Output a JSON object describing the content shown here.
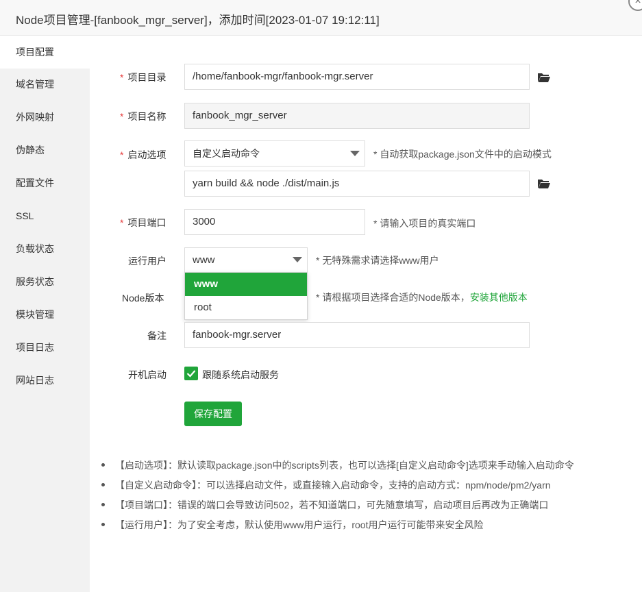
{
  "window": {
    "title": "Node项目管理-[fanbook_mgr_server]，添加时间[2023-01-07 19:12:11]",
    "close_glyph": "×"
  },
  "sidebar": {
    "items": [
      {
        "label": "项目配置",
        "active": true
      },
      {
        "label": "域名管理"
      },
      {
        "label": "外网映射"
      },
      {
        "label": "伪静态"
      },
      {
        "label": "配置文件"
      },
      {
        "label": "SSL"
      },
      {
        "label": "负载状态"
      },
      {
        "label": "服务状态"
      },
      {
        "label": "模块管理"
      },
      {
        "label": "项目日志"
      },
      {
        "label": "网站日志"
      }
    ]
  },
  "form": {
    "required_mark": "*",
    "project_dir": {
      "label": "项目目录",
      "value": "/home/fanbook-mgr/fanbook-mgr.server"
    },
    "project_name": {
      "label": "项目名称",
      "value": "fanbook_mgr_server"
    },
    "start_option": {
      "label": "启动选项",
      "selected": "自定义启动命令",
      "hint": "* 自动获取package.json文件中的启动模式",
      "command": "yarn build && node ./dist/main.js"
    },
    "port": {
      "label": "项目端口",
      "value": "3000",
      "hint": "* 请输入项目的真实端口"
    },
    "run_user": {
      "label": "运行用户",
      "selected": "www",
      "hint": "* 无特殊需求请选择www用户",
      "options": [
        "www",
        "root"
      ]
    },
    "node_version": {
      "label": "Node版本",
      "hint": "* 请根据项目选择合适的Node版本，",
      "link": "安装其他版本"
    },
    "remark": {
      "label": "备注",
      "value": "fanbook-mgr.server"
    },
    "autostart": {
      "label": "开机启动",
      "checkbox_label": "跟随系统启动服务",
      "checked": true
    },
    "save_label": "保存配置"
  },
  "notes": [
    "【启动选项】：默认读取package.json中的scripts列表，也可以选择[自定义启动命令]选项来手动输入启动命令",
    "【自定义启动命令】：可以选择启动文件，或直接输入启动命令，支持的启动方式：npm/node/pm2/yarn",
    "【项目端口】：错误的端口会导致访问502，若不知道端口，可先随意填写，启动项目后再改为正确端口",
    "【运行用户】：为了安全考虑，默认使用www用户运行，root用户运行可能带来安全风险"
  ],
  "colors": {
    "accent": "#20a53a",
    "required": "#e53b3b",
    "sidebar_bg": "#f2f2f2"
  }
}
